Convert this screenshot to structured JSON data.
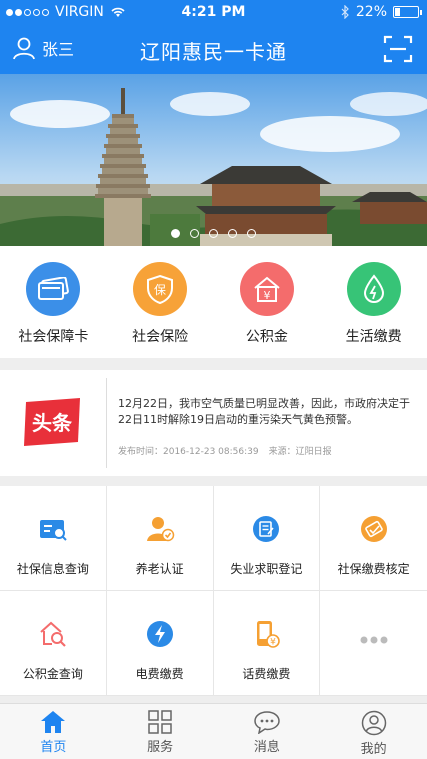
{
  "status_bar": {
    "carrier": "VIRGIN",
    "time": "4:21 PM",
    "battery": "22%"
  },
  "header": {
    "user_name": "张三",
    "title": "辽阳惠民一卡通"
  },
  "banner": {
    "slide_count": 5,
    "active_slide": 1
  },
  "services": [
    {
      "label": "社会保障卡",
      "icon": "card-icon",
      "color": "#3b8fe8"
    },
    {
      "label": "社会保险",
      "icon": "insurance-icon",
      "color": "#f7a238"
    },
    {
      "label": "公积金",
      "icon": "fund-icon",
      "color": "#f46c6c"
    },
    {
      "label": "生活缴费",
      "icon": "water-drop-icon",
      "color": "#37c477"
    }
  ],
  "news": {
    "logo_text": "头条",
    "text": "12月22日，我市空气质量已明显改善，因此，市政府决定于22日11时解除19日启动的重污染天气黄色预警。",
    "published": "发布时间：2016-12-23 08:56:39",
    "source": "来源：辽阳日报"
  },
  "grid": [
    {
      "label": "社保信息查询",
      "icon": "id-card-search-icon"
    },
    {
      "label": "养老认证",
      "icon": "user-verified-icon"
    },
    {
      "label": "失业求职登记",
      "icon": "register-form-icon"
    },
    {
      "label": "社保缴费核定",
      "icon": "payment-check-icon"
    },
    {
      "label": "公积金查询",
      "icon": "house-search-icon"
    },
    {
      "label": "电费缴费",
      "icon": "lightning-icon"
    },
    {
      "label": "话费缴费",
      "icon": "phone-bill-icon"
    },
    {
      "label": "",
      "icon": "more-dots-icon"
    }
  ],
  "tabbar": [
    {
      "label": "首页",
      "icon": "home-icon",
      "active": true
    },
    {
      "label": "服务",
      "icon": "grid-icon",
      "active": false
    },
    {
      "label": "消息",
      "icon": "chat-bubble-icon",
      "active": false
    },
    {
      "label": "我的",
      "icon": "profile-icon",
      "active": false
    }
  ],
  "colors": {
    "brand": "#1e84f0",
    "news_logo": "#e8303a",
    "grid_icon_blue": "#2b8ae6",
    "grid_icon_orange": "#f5a033"
  }
}
